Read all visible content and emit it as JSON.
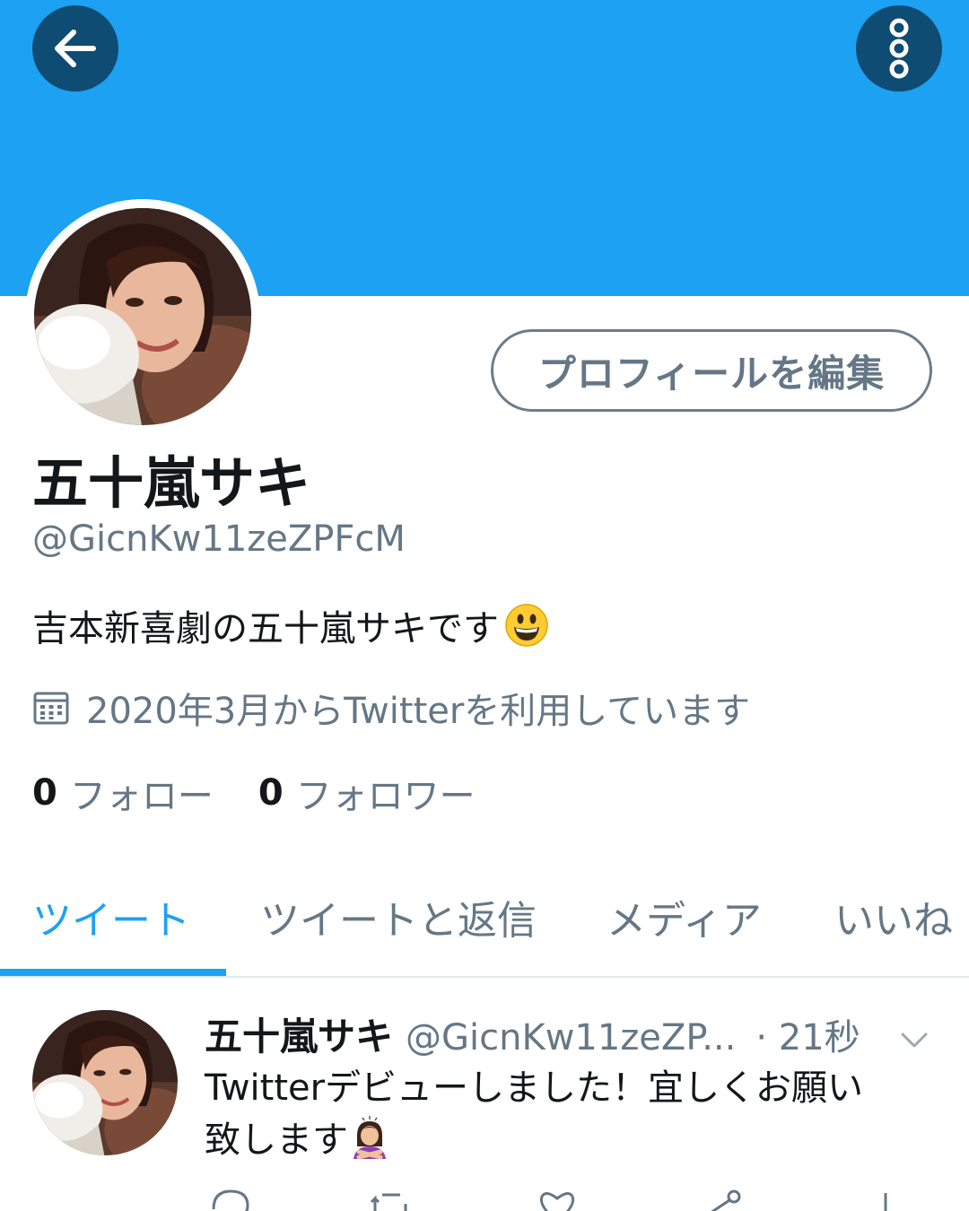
{
  "header": {
    "back_icon": "arrow-left-icon",
    "more_icon": "vertical-dots-icon",
    "banner_color": "#1da1f2"
  },
  "profile": {
    "edit_button": "プロフィールを編集",
    "display_name": "五十嵐サキ",
    "handle": "@GicnKw11zeZPFcM",
    "bio": "吉本新喜劇の五十嵐サキです",
    "joined": "2020年3月からTwitterを利用しています",
    "following_count": "0",
    "following_label": "フォロー",
    "followers_count": "0",
    "followers_label": "フォロワー"
  },
  "tabs": [
    {
      "label": "ツイート",
      "active": true
    },
    {
      "label": "ツイートと返信",
      "active": false
    },
    {
      "label": "メディア",
      "active": false
    },
    {
      "label": "いいね",
      "active": false
    }
  ],
  "tweet": {
    "name": "五十嵐サキ",
    "handle": "@GicnKw11zeZP...",
    "time": "· 21秒",
    "text_line1": "Twitterデビューしました！宜しくお願い",
    "text_line2": "致します"
  },
  "colors": {
    "accent": "#1da1f2",
    "secondary_text": "#657786",
    "primary_text": "#14171a",
    "button_dark": "#0f4c73"
  }
}
